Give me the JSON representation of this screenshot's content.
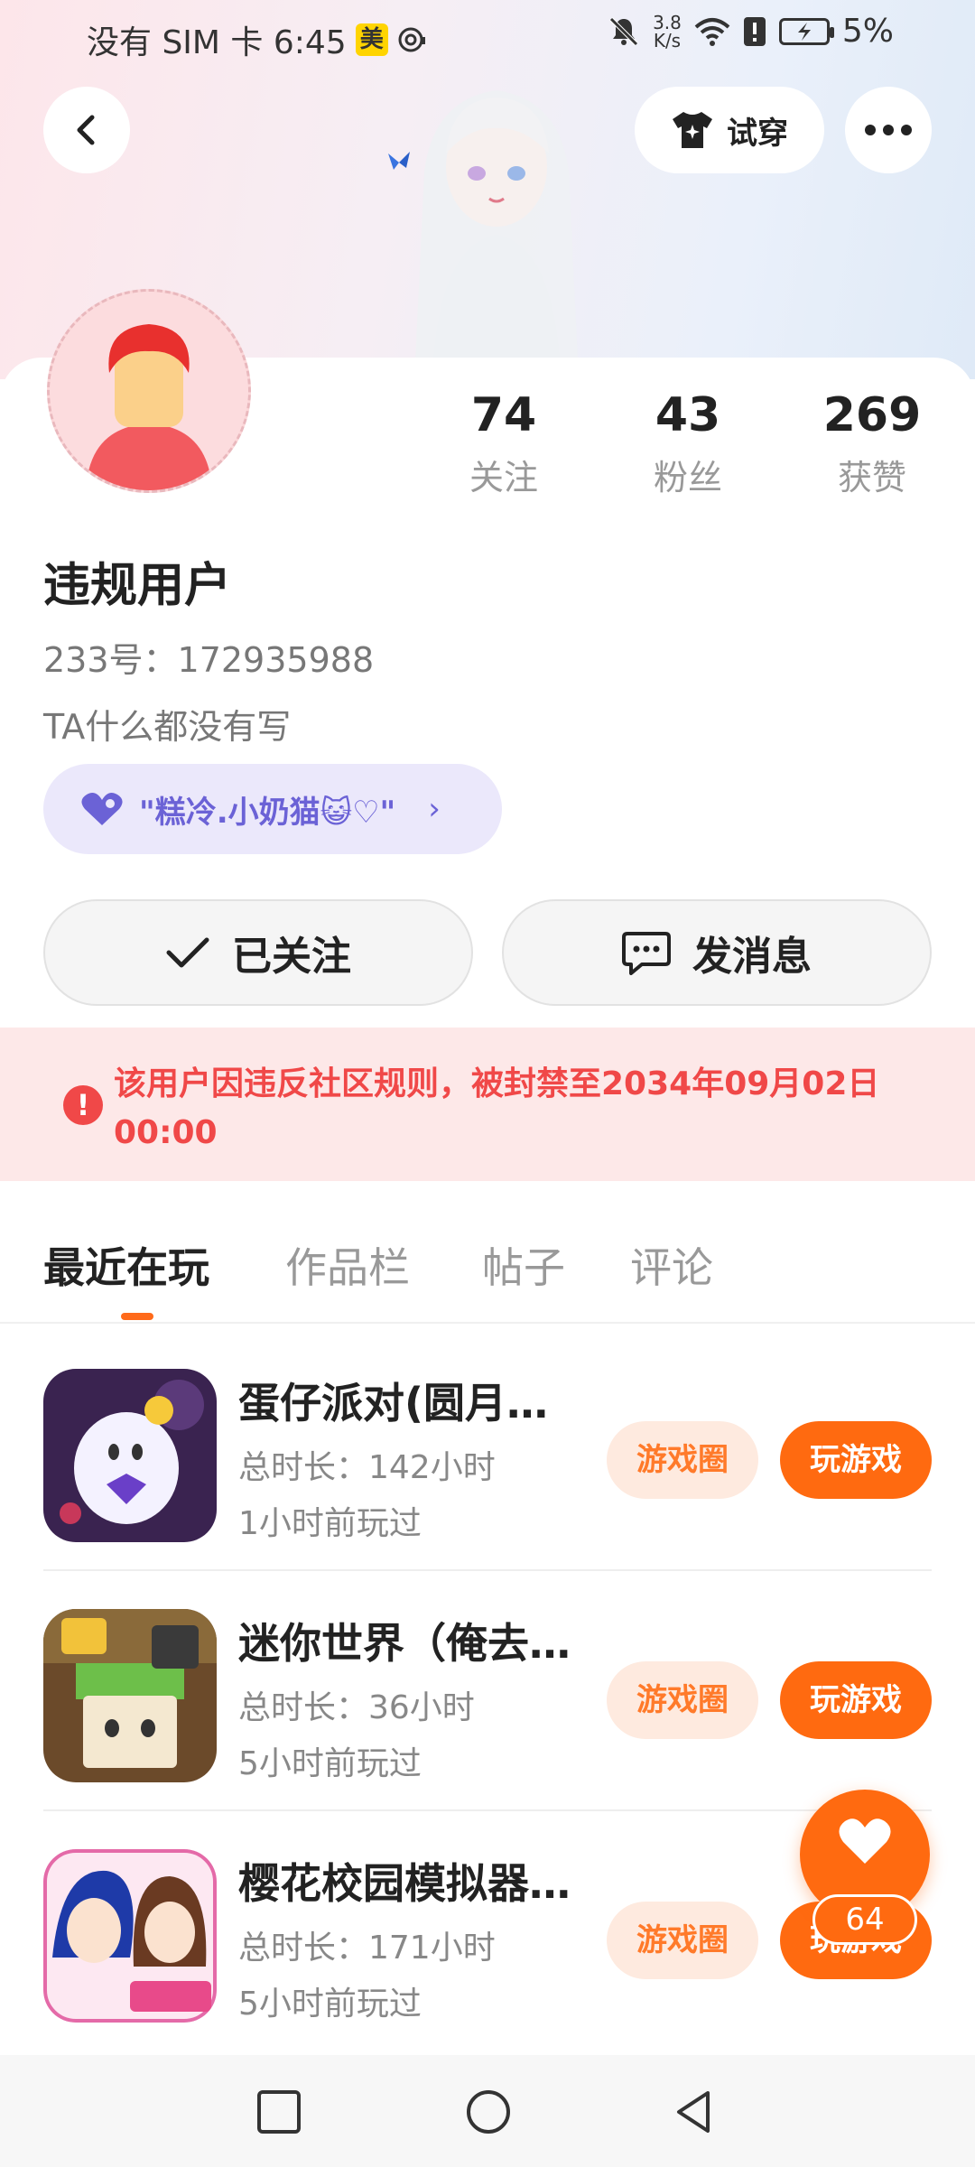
{
  "status_bar": {
    "left_text": "没有 SIM 卡 6:45",
    "badge": "美",
    "net_speed_value": "3.8",
    "net_speed_unit": "K/s",
    "battery": "5%"
  },
  "header": {
    "tryon_label": "试穿"
  },
  "profile": {
    "stats": [
      {
        "value": "74",
        "label": "关注"
      },
      {
        "value": "43",
        "label": "粉丝"
      },
      {
        "value": "269",
        "label": "获赞"
      }
    ],
    "username": "违规用户",
    "uid": "233号：172935988",
    "bio": "TA什么都没有写",
    "guild": "\"糕冷.小奶猫😺♡\""
  },
  "actions": {
    "follow_label": "已关注",
    "message_label": "发消息"
  },
  "ban_notice": "该用户因违反社区规则，被封禁至2034年09月02日 00:00",
  "tabs": [
    "最近在玩",
    "作品栏",
    "帖子",
    "评论"
  ],
  "games": [
    {
      "title": "蛋仔派对(圆月…",
      "duration": "总时长：142小时",
      "last_played": "1小时前玩过",
      "circle_label": "游戏圈",
      "play_label": "玩游戏"
    },
    {
      "title": "迷你世界（俺去…",
      "duration": "总时长：36小时",
      "last_played": "5小时前玩过",
      "circle_label": "游戏圈",
      "play_label": "玩游戏"
    },
    {
      "title": "樱花校园模拟器…",
      "duration": "总时长：171小时",
      "last_played": "5小时前玩过",
      "circle_label": "游戏圈",
      "play_label": "玩游戏"
    }
  ],
  "like_fab": {
    "count": "64"
  },
  "colors": {
    "accent": "#ff6a10",
    "ban_text": "#f04848",
    "ban_bg": "#fde8e8",
    "guild": "#6b62d6"
  }
}
